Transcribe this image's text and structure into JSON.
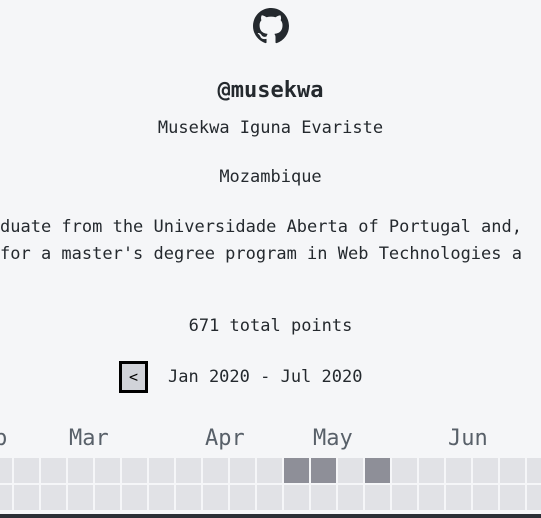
{
  "profile": {
    "handle": "@musekwa",
    "name": "Musekwa Iguna Evariste",
    "location": "Mozambique",
    "bio_line1": "duate from the Universidade Aberta of Portugal and,",
    "bio_line2": "for a master's degree program in Web Technologies a"
  },
  "stats": {
    "total_points": "671 total points"
  },
  "calendar": {
    "prev_label": "<",
    "range": "Jan 2020 - Jul 2020",
    "months": [
      "b",
      "Mar",
      "Apr",
      "May",
      "Jun"
    ],
    "row1_levels": [
      0,
      0,
      0,
      0,
      0,
      0,
      0,
      0,
      0,
      0,
      0,
      0,
      0,
      0,
      0,
      0,
      0,
      0,
      0,
      0,
      0,
      0,
      0,
      0,
      0,
      0,
      0,
      0,
      0,
      0,
      0,
      0,
      0,
      0,
      0,
      0,
      0,
      0,
      0,
      0,
      0,
      0,
      0,
      0,
      0,
      0,
      0,
      0,
      0,
      0,
      0,
      0,
      0,
      0,
      0,
      0,
      0,
      0,
      0,
      0,
      0,
      0,
      0,
      0,
      0,
      0,
      0,
      0,
      0,
      0,
      0,
      0,
      0,
      0,
      0,
      0,
      0,
      0,
      0,
      0,
      0,
      0,
      0,
      0,
      0,
      0,
      0,
      0,
      0,
      0,
      0,
      0,
      0,
      0,
      0,
      0,
      0,
      0,
      0,
      0,
      0,
      0,
      0,
      0,
      0,
      0,
      0,
      0,
      0,
      0,
      0,
      0,
      0,
      0,
      0,
      0,
      0,
      0,
      0,
      0,
      0,
      0,
      0,
      0,
      0,
      0,
      0,
      0,
      0,
      0,
      0,
      0,
      0,
      0,
      0,
      0,
      0,
      0,
      0,
      0,
      0,
      0,
      0,
      0,
      0,
      0,
      0,
      0,
      0,
      0,
      0,
      0,
      0,
      0,
      0,
      0,
      0,
      0,
      0,
      0,
      0,
      0,
      0,
      0,
      0,
      0,
      0,
      0,
      0,
      0,
      0,
      0,
      0,
      0,
      0,
      0,
      0,
      0,
      0,
      0,
      0,
      0,
      0,
      0,
      0,
      0,
      0,
      0,
      0,
      0,
      0,
      0,
      0,
      0,
      0,
      0,
      0,
      0,
      0,
      0
    ],
    "row1_active": [
      11,
      12,
      14
    ],
    "row2_active": []
  },
  "icons": {
    "logo": "github-icon"
  }
}
